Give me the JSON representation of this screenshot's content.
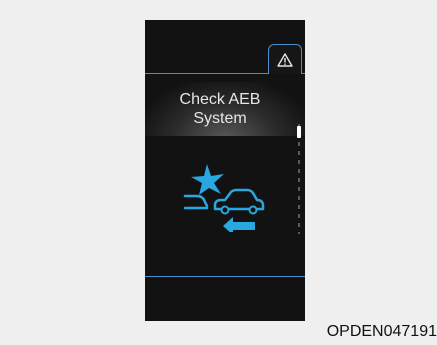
{
  "cluster_display": {
    "tab_icon": "warning-triangle-icon",
    "message": {
      "line1": "Check AEB",
      "line2": "System"
    },
    "graphic_icon": "aeb-collision-icon",
    "accent_color": "#4a8fcf",
    "symbol_color": "#29a7e1",
    "background_color": "#121212"
  },
  "caption": "OPDEN047191"
}
